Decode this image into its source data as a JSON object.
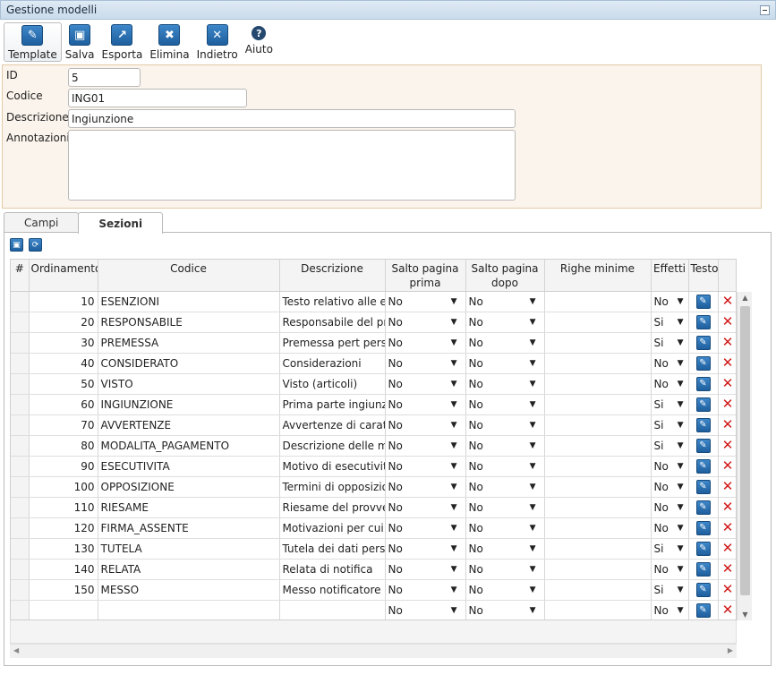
{
  "window": {
    "title": "Gestione modelli"
  },
  "toolbar": [
    {
      "label": "Template",
      "icon": "template-icon",
      "glyph": "✎"
    },
    {
      "label": "Salva",
      "icon": "save-icon",
      "glyph": "▣"
    },
    {
      "label": "Esporta",
      "icon": "export-icon",
      "glyph": "↗"
    },
    {
      "label": "Elimina",
      "icon": "delete-icon",
      "glyph": "✖"
    },
    {
      "label": "Indietro",
      "icon": "back-icon",
      "glyph": "✕"
    },
    {
      "label": "Aiuto",
      "icon": "help-icon",
      "glyph": "?"
    }
  ],
  "form": {
    "id_label": "ID",
    "id_value": "5",
    "codice_label": "Codice",
    "codice_value": "ING01",
    "descrizione_label": "Descrizione",
    "descrizione_value": "Ingiunzione",
    "annotazioni_label": "Annotazioni",
    "annotazioni_value": ""
  },
  "tabs": [
    {
      "label": "Campi",
      "active": false
    },
    {
      "label": "Sezioni",
      "active": true
    }
  ],
  "grid": {
    "headers": {
      "hash": "#",
      "ordinamento": "Ordinamento",
      "codice": "Codice",
      "descrizione": "Descrizione",
      "salto_prima_1": "Salto pagina",
      "salto_prima_2": "prima",
      "salto_dopo_1": "Salto pagina",
      "salto_dopo_2": "dopo",
      "righe_minime": "Righe minime",
      "effetti": "Effetti",
      "testo": "Testo"
    },
    "rows": [
      {
        "ordinamento": "10",
        "codice": "ESENZIONI",
        "descrizione": "Testo relativo alle es",
        "salto_prima": "No",
        "salto_dopo": "No",
        "righe_minime": "",
        "effetti": "No"
      },
      {
        "ordinamento": "20",
        "codice": "RESPONSABILE",
        "descrizione": "Responsabile del pro",
        "salto_prima": "No",
        "salto_dopo": "No",
        "righe_minime": "",
        "effetti": "Si"
      },
      {
        "ordinamento": "30",
        "codice": "PREMESSA",
        "descrizione": "Premessa pert perso",
        "salto_prima": "No",
        "salto_dopo": "No",
        "righe_minime": "",
        "effetti": "Si"
      },
      {
        "ordinamento": "40",
        "codice": "CONSIDERATO",
        "descrizione": "Considerazioni",
        "salto_prima": "No",
        "salto_dopo": "No",
        "righe_minime": "",
        "effetti": "No"
      },
      {
        "ordinamento": "50",
        "codice": "VISTO",
        "descrizione": "Visto (articoli)",
        "salto_prima": "No",
        "salto_dopo": "No",
        "righe_minime": "",
        "effetti": "No"
      },
      {
        "ordinamento": "60",
        "codice": "INGIUNZIONE",
        "descrizione": "Prima parte ingiunzio",
        "salto_prima": "No",
        "salto_dopo": "No",
        "righe_minime": "",
        "effetti": "Si"
      },
      {
        "ordinamento": "70",
        "codice": "AVVERTENZE",
        "descrizione": "Avvertenze di caratte",
        "salto_prima": "No",
        "salto_dopo": "No",
        "righe_minime": "",
        "effetti": "Si"
      },
      {
        "ordinamento": "80",
        "codice": "MODALITA_PAGAMENTO",
        "descrizione": "Descrizione delle mo",
        "salto_prima": "No",
        "salto_dopo": "No",
        "righe_minime": "",
        "effetti": "Si"
      },
      {
        "ordinamento": "90",
        "codice": "ESECUTIVITA",
        "descrizione": "Motivo di esecutività",
        "salto_prima": "No",
        "salto_dopo": "No",
        "righe_minime": "",
        "effetti": "No"
      },
      {
        "ordinamento": "100",
        "codice": "OPPOSIZIONE",
        "descrizione": "Termini di opposizio",
        "salto_prima": "No",
        "salto_dopo": "No",
        "righe_minime": "",
        "effetti": "No"
      },
      {
        "ordinamento": "110",
        "codice": "RIESAME",
        "descrizione": "Riesame del provvec",
        "salto_prima": "No",
        "salto_dopo": "No",
        "righe_minime": "",
        "effetti": "No"
      },
      {
        "ordinamento": "120",
        "codice": "FIRMA_ASSENTE",
        "descrizione": "Motivazioni per cui l'",
        "salto_prima": "No",
        "salto_dopo": "No",
        "righe_minime": "",
        "effetti": "No"
      },
      {
        "ordinamento": "130",
        "codice": "TUTELA",
        "descrizione": "Tutela dei dati perso",
        "salto_prima": "No",
        "salto_dopo": "No",
        "righe_minime": "",
        "effetti": "Si"
      },
      {
        "ordinamento": "140",
        "codice": "RELATA",
        "descrizione": "Relata di notifica",
        "salto_prima": "No",
        "salto_dopo": "No",
        "righe_minime": "",
        "effetti": "No"
      },
      {
        "ordinamento": "150",
        "codice": "MESSO",
        "descrizione": "Messo notificatore",
        "salto_prima": "No",
        "salto_dopo": "No",
        "righe_minime": "",
        "effetti": "Si"
      },
      {
        "ordinamento": "",
        "codice": "",
        "descrizione": "",
        "salto_prima": "No",
        "salto_dopo": "No",
        "righe_minime": "",
        "effetti": "No"
      }
    ]
  },
  "colors": {
    "accent_blue": "#2a6fb0",
    "delete_red": "#d01818",
    "form_bg": "#fbf4ec",
    "form_border": "#e2c9a6"
  }
}
